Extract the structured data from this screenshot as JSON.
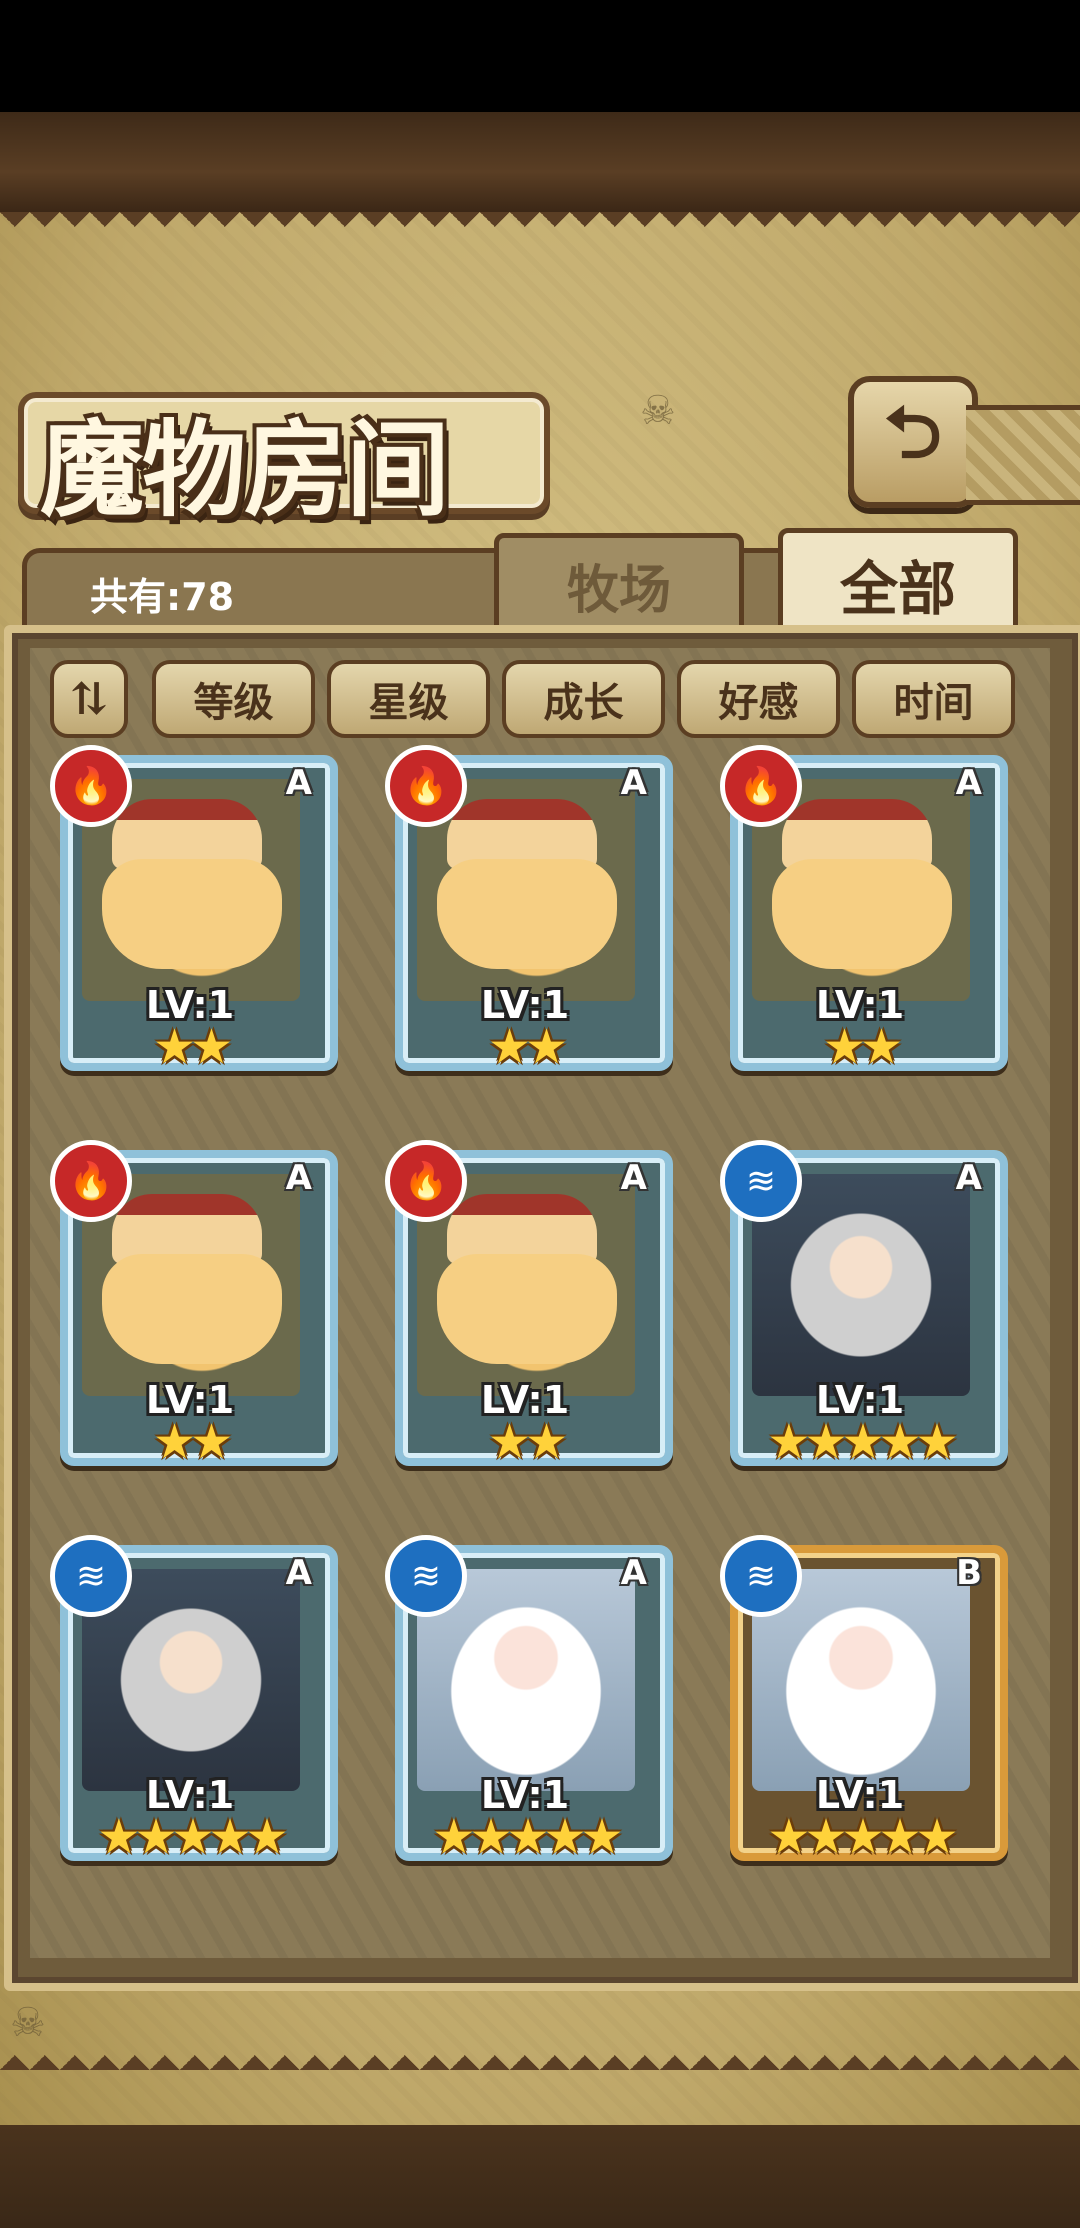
{
  "header": {
    "title": "魔物房间",
    "back_icon": "⮌"
  },
  "summary": {
    "count_label": "共有:78"
  },
  "tabs": [
    {
      "label": "牧场",
      "active": false
    },
    {
      "label": "全部",
      "active": true
    }
  ],
  "sort": {
    "toggle_icon": "⇅",
    "options": [
      "等级",
      "星级",
      "成长",
      "好感",
      "时间"
    ]
  },
  "monsters": [
    {
      "element": "fire",
      "element_icon": "🔥",
      "rank": "A",
      "level": "LV:1",
      "stars": "★★",
      "type": "pudding",
      "frame": "blue"
    },
    {
      "element": "fire",
      "element_icon": "🔥",
      "rank": "A",
      "level": "LV:1",
      "stars": "★★",
      "type": "pudding",
      "frame": "blue"
    },
    {
      "element": "fire",
      "element_icon": "🔥",
      "rank": "A",
      "level": "LV:1",
      "stars": "★★",
      "type": "pudding",
      "frame": "blue"
    },
    {
      "element": "fire",
      "element_icon": "🔥",
      "rank": "A",
      "level": "LV:1",
      "stars": "★★",
      "type": "pudding",
      "frame": "blue"
    },
    {
      "element": "fire",
      "element_icon": "🔥",
      "rank": "A",
      "level": "LV:1",
      "stars": "★★",
      "type": "pudding",
      "frame": "blue"
    },
    {
      "element": "water",
      "element_icon": "≋",
      "rank": "A",
      "level": "LV:1",
      "stars": "★★★★★",
      "type": "hood",
      "frame": "blue"
    },
    {
      "element": "water",
      "element_icon": "≋",
      "rank": "A",
      "level": "LV:1",
      "stars": "★★★★★",
      "type": "hood",
      "frame": "blue"
    },
    {
      "element": "water",
      "element_icon": "≋",
      "rank": "A",
      "level": "LV:1",
      "stars": "★★★★★",
      "type": "angel",
      "frame": "blue"
    },
    {
      "element": "water",
      "element_icon": "≋",
      "rank": "B",
      "level": "LV:1",
      "stars": "★★★★★",
      "type": "angel",
      "frame": "gold"
    }
  ]
}
